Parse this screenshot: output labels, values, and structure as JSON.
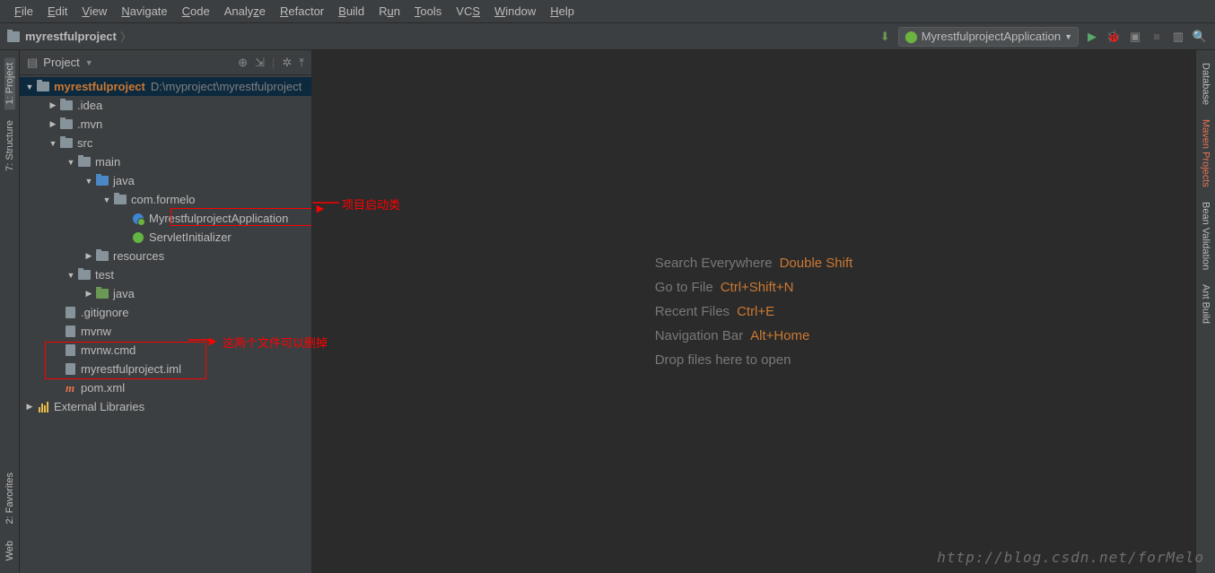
{
  "menu": [
    "File",
    "Edit",
    "View",
    "Navigate",
    "Code",
    "Analyze",
    "Refactor",
    "Build",
    "Run",
    "Tools",
    "VCS",
    "Window",
    "Help"
  ],
  "breadcrumb": {
    "project": "myrestfulproject"
  },
  "runConfig": {
    "name": "MyrestfulprojectApplication"
  },
  "panel": {
    "title": "Project"
  },
  "tree": {
    "root": {
      "name": "myrestfulproject",
      "path": "D:\\myproject\\myrestfulproject"
    },
    "idea": ".idea",
    "mvn": ".mvn",
    "src": "src",
    "main": "main",
    "java": "java",
    "pkg": "com.formelo",
    "app": "MyrestfulprojectApplication",
    "servlet": "ServletInitializer",
    "resources": "resources",
    "test": "test",
    "testjava": "java",
    "gitignore": ".gitignore",
    "mvnw": "mvnw",
    "mvnwcmd": "mvnw.cmd",
    "iml": "myrestfulproject.iml",
    "pom": "pom.xml",
    "extlibs": "External Libraries"
  },
  "annotations": {
    "startupClass": "项目启动类",
    "canDelete": "这两个文件可以删掉"
  },
  "hints": {
    "search": {
      "label": "Search Everywhere",
      "key": "Double Shift"
    },
    "goto": {
      "label": "Go to File",
      "key": "Ctrl+Shift+N"
    },
    "recent": {
      "label": "Recent Files",
      "key": "Ctrl+E"
    },
    "nav": {
      "label": "Navigation Bar",
      "key": "Alt+Home"
    },
    "drop": {
      "label": "Drop files here to open"
    }
  },
  "leftTabs": {
    "project": "1: Project",
    "structure": "7: Structure",
    "favorites": "2: Favorites",
    "web": "Web"
  },
  "rightTabs": {
    "database": "Database",
    "maven": "Maven Projects",
    "bean": "Bean Validation",
    "ant": "Ant Build"
  },
  "watermark": "http://blog.csdn.net/forMelo"
}
